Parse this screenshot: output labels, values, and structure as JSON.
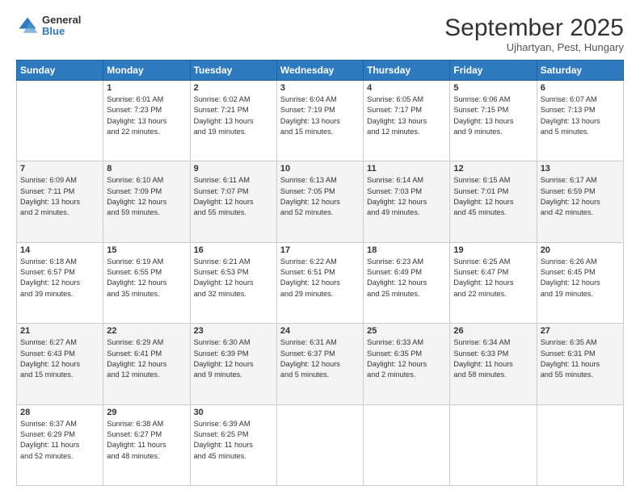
{
  "logo": {
    "line1": "General",
    "line2": "Blue"
  },
  "title": "September 2025",
  "location": "Ujhartyan, Pest, Hungary",
  "days_header": [
    "Sunday",
    "Monday",
    "Tuesday",
    "Wednesday",
    "Thursday",
    "Friday",
    "Saturday"
  ],
  "weeks": [
    [
      {
        "day": "",
        "info": ""
      },
      {
        "day": "1",
        "info": "Sunrise: 6:01 AM\nSunset: 7:23 PM\nDaylight: 13 hours\nand 22 minutes."
      },
      {
        "day": "2",
        "info": "Sunrise: 6:02 AM\nSunset: 7:21 PM\nDaylight: 13 hours\nand 19 minutes."
      },
      {
        "day": "3",
        "info": "Sunrise: 6:04 AM\nSunset: 7:19 PM\nDaylight: 13 hours\nand 15 minutes."
      },
      {
        "day": "4",
        "info": "Sunrise: 6:05 AM\nSunset: 7:17 PM\nDaylight: 13 hours\nand 12 minutes."
      },
      {
        "day": "5",
        "info": "Sunrise: 6:06 AM\nSunset: 7:15 PM\nDaylight: 13 hours\nand 9 minutes."
      },
      {
        "day": "6",
        "info": "Sunrise: 6:07 AM\nSunset: 7:13 PM\nDaylight: 13 hours\nand 5 minutes."
      }
    ],
    [
      {
        "day": "7",
        "info": "Sunrise: 6:09 AM\nSunset: 7:11 PM\nDaylight: 13 hours\nand 2 minutes."
      },
      {
        "day": "8",
        "info": "Sunrise: 6:10 AM\nSunset: 7:09 PM\nDaylight: 12 hours\nand 59 minutes."
      },
      {
        "day": "9",
        "info": "Sunrise: 6:11 AM\nSunset: 7:07 PM\nDaylight: 12 hours\nand 55 minutes."
      },
      {
        "day": "10",
        "info": "Sunrise: 6:13 AM\nSunset: 7:05 PM\nDaylight: 12 hours\nand 52 minutes."
      },
      {
        "day": "11",
        "info": "Sunrise: 6:14 AM\nSunset: 7:03 PM\nDaylight: 12 hours\nand 49 minutes."
      },
      {
        "day": "12",
        "info": "Sunrise: 6:15 AM\nSunset: 7:01 PM\nDaylight: 12 hours\nand 45 minutes."
      },
      {
        "day": "13",
        "info": "Sunrise: 6:17 AM\nSunset: 6:59 PM\nDaylight: 12 hours\nand 42 minutes."
      }
    ],
    [
      {
        "day": "14",
        "info": "Sunrise: 6:18 AM\nSunset: 6:57 PM\nDaylight: 12 hours\nand 39 minutes."
      },
      {
        "day": "15",
        "info": "Sunrise: 6:19 AM\nSunset: 6:55 PM\nDaylight: 12 hours\nand 35 minutes."
      },
      {
        "day": "16",
        "info": "Sunrise: 6:21 AM\nSunset: 6:53 PM\nDaylight: 12 hours\nand 32 minutes."
      },
      {
        "day": "17",
        "info": "Sunrise: 6:22 AM\nSunset: 6:51 PM\nDaylight: 12 hours\nand 29 minutes."
      },
      {
        "day": "18",
        "info": "Sunrise: 6:23 AM\nSunset: 6:49 PM\nDaylight: 12 hours\nand 25 minutes."
      },
      {
        "day": "19",
        "info": "Sunrise: 6:25 AM\nSunset: 6:47 PM\nDaylight: 12 hours\nand 22 minutes."
      },
      {
        "day": "20",
        "info": "Sunrise: 6:26 AM\nSunset: 6:45 PM\nDaylight: 12 hours\nand 19 minutes."
      }
    ],
    [
      {
        "day": "21",
        "info": "Sunrise: 6:27 AM\nSunset: 6:43 PM\nDaylight: 12 hours\nand 15 minutes."
      },
      {
        "day": "22",
        "info": "Sunrise: 6:29 AM\nSunset: 6:41 PM\nDaylight: 12 hours\nand 12 minutes."
      },
      {
        "day": "23",
        "info": "Sunrise: 6:30 AM\nSunset: 6:39 PM\nDaylight: 12 hours\nand 9 minutes."
      },
      {
        "day": "24",
        "info": "Sunrise: 6:31 AM\nSunset: 6:37 PM\nDaylight: 12 hours\nand 5 minutes."
      },
      {
        "day": "25",
        "info": "Sunrise: 6:33 AM\nSunset: 6:35 PM\nDaylight: 12 hours\nand 2 minutes."
      },
      {
        "day": "26",
        "info": "Sunrise: 6:34 AM\nSunset: 6:33 PM\nDaylight: 11 hours\nand 58 minutes."
      },
      {
        "day": "27",
        "info": "Sunrise: 6:35 AM\nSunset: 6:31 PM\nDaylight: 11 hours\nand 55 minutes."
      }
    ],
    [
      {
        "day": "28",
        "info": "Sunrise: 6:37 AM\nSunset: 6:29 PM\nDaylight: 11 hours\nand 52 minutes."
      },
      {
        "day": "29",
        "info": "Sunrise: 6:38 AM\nSunset: 6:27 PM\nDaylight: 11 hours\nand 48 minutes."
      },
      {
        "day": "30",
        "info": "Sunrise: 6:39 AM\nSunset: 6:25 PM\nDaylight: 11 hours\nand 45 minutes."
      },
      {
        "day": "",
        "info": ""
      },
      {
        "day": "",
        "info": ""
      },
      {
        "day": "",
        "info": ""
      },
      {
        "day": "",
        "info": ""
      }
    ]
  ]
}
